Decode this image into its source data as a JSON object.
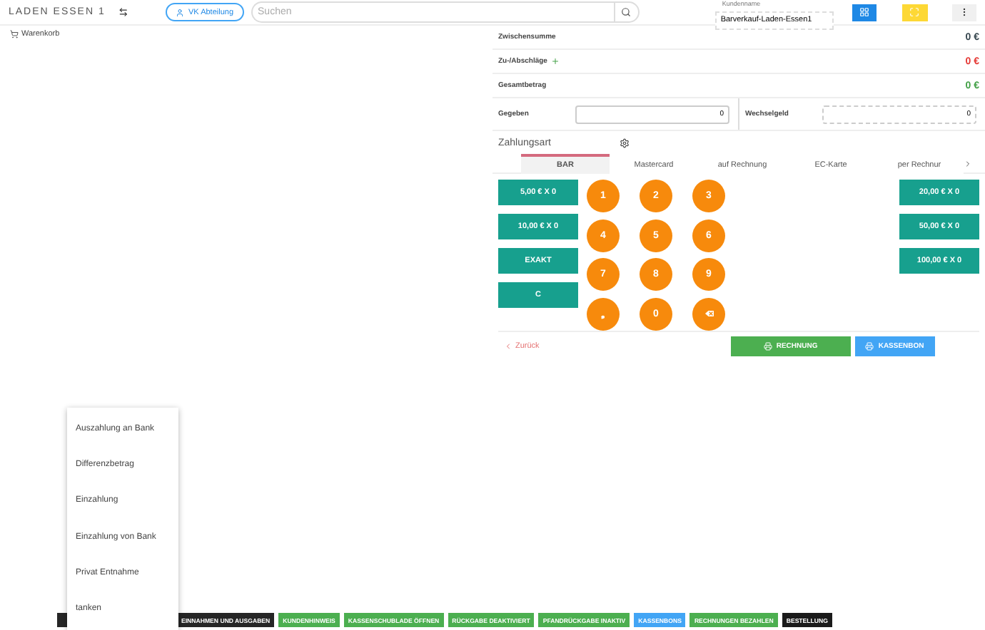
{
  "header": {
    "store": "LADEN ESSEN 1",
    "department": "VK Abteilung",
    "search_placeholder": "Suchen",
    "customer_label": "Kundenname",
    "customer_value": "Barverkauf-Laden-Essen1"
  },
  "cart": {
    "title": "Warenkorb"
  },
  "totals": [
    {
      "label": "Zwischensumme",
      "value": "0 €",
      "color": "#37474f",
      "addable": false
    },
    {
      "label": "Zu-/Abschläge",
      "value": "0 €",
      "color": "#e53935",
      "addable": true
    },
    {
      "label": "Gesamtbetrag",
      "value": "0 €",
      "color": "#43a047",
      "addable": false
    }
  ],
  "given": {
    "label": "Gegeben",
    "value": "0"
  },
  "change": {
    "label": "Wechselgeld",
    "value": "0"
  },
  "payment": {
    "title": "Zahlungsart",
    "tabs": [
      {
        "label": "BAR",
        "selected": true
      },
      {
        "label": "Mastercard",
        "selected": false
      },
      {
        "label": "auf Rechnung",
        "selected": false
      },
      {
        "label": "EC-Karte",
        "selected": false
      },
      {
        "label": "per Rechnur",
        "selected": false
      }
    ]
  },
  "amounts_left": [
    "5,00 € X 0",
    "10,00 € X 0",
    "EXAKT",
    "C"
  ],
  "keypad": [
    {
      "kind": "digit",
      "label": "1"
    },
    {
      "kind": "digit",
      "label": "2"
    },
    {
      "kind": "digit",
      "label": "3"
    },
    {
      "kind": "digit",
      "label": "4"
    },
    {
      "kind": "digit",
      "label": "5"
    },
    {
      "kind": "digit",
      "label": "6"
    },
    {
      "kind": "digit",
      "label": "7"
    },
    {
      "kind": "digit",
      "label": "8"
    },
    {
      "kind": "digit",
      "label": "9"
    },
    {
      "kind": "digit",
      "label": "❟"
    },
    {
      "kind": "digit",
      "label": "0"
    },
    {
      "kind": "backspace"
    }
  ],
  "amounts_right": [
    "20,00 € X 0",
    "50,00 € X 0",
    "100,00 € X 0"
  ],
  "back": "Zurück",
  "actions": [
    {
      "label": "RECHNUNG",
      "color": "#4caf50"
    },
    {
      "label": "KASSENBON",
      "color": "#42a5f5"
    }
  ],
  "menu": {
    "items": [
      "Auszahlung an Bank",
      "Differenzbetrag",
      "Einzahlung",
      "Einzahlung von Bank",
      "Privat Entnahme",
      "tanken"
    ]
  },
  "bottom_buttons": [
    {
      "label": "EINNAHMEN UND AUSGABEN",
      "color": "#262626"
    },
    {
      "label": "KUNDENHINWEIS",
      "color": "#4caf50"
    },
    {
      "label": "KASSENSCHUBLADE ÖFFNEN",
      "color": "#4caf50"
    },
    {
      "label": "RÜCKGABE DEAKTIVIERT",
      "color": "#4caf50"
    },
    {
      "label": "PFANDRÜCKGABE INAKTIV",
      "color": "#4caf50"
    },
    {
      "label": "KASSENBONS",
      "color": "#42a5f5"
    },
    {
      "label": "RECHNUNGEN BEZAHLEN",
      "color": "#4caf50"
    },
    {
      "label": "BESTELLUNG",
      "color": "#1a1a1a"
    }
  ]
}
